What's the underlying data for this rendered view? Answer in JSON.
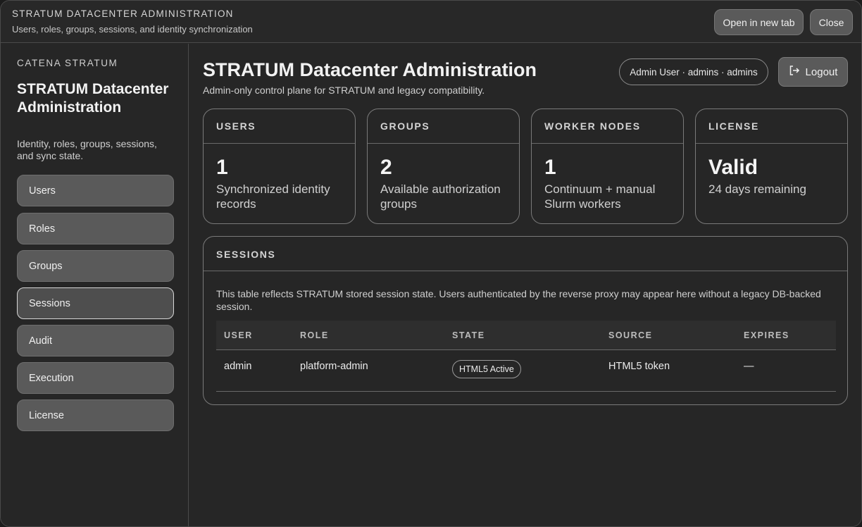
{
  "titlebar": {
    "heading": "STRATUM DATACENTER ADMINISTRATION",
    "subheading": "Users, roles, groups, sessions, and identity synchronization",
    "open_new_tab_label": "Open in new tab",
    "close_label": "Close"
  },
  "sidebar": {
    "brand": "CATENA STRATUM",
    "title": "STRATUM Datacenter Administration",
    "subtitle": "Identity, roles, groups, sessions, and sync state.",
    "items": [
      {
        "label": "Users"
      },
      {
        "label": "Roles"
      },
      {
        "label": "Groups"
      },
      {
        "label": "Sessions",
        "active": true
      },
      {
        "label": "Audit"
      },
      {
        "label": "Execution"
      },
      {
        "label": "License"
      }
    ]
  },
  "header": {
    "title": "STRATUM Datacenter Administration",
    "subtitle": "Admin-only control plane for STRATUM and legacy compatibility.",
    "user_pill": "Admin User · admins · admins",
    "logout_label": "Logout",
    "logout_icon": "logout-icon"
  },
  "cards": [
    {
      "heading": "USERS",
      "value": "1",
      "description": "Synchronized identity records"
    },
    {
      "heading": "GROUPS",
      "value": "2",
      "description": "Available authorization groups"
    },
    {
      "heading": "WORKER NODES",
      "value": "1",
      "description": "Continuum + manual Slurm workers"
    },
    {
      "heading": "LICENSE",
      "value": "Valid",
      "description": "24 days remaining"
    }
  ],
  "sessions": {
    "heading": "SESSIONS",
    "note": "This table reflects STRATUM stored session state. Users authenticated by the reverse proxy may appear here without a legacy DB-backed session.",
    "columns": [
      "USER",
      "ROLE",
      "STATE",
      "SOURCE",
      "EXPIRES"
    ],
    "rows": [
      {
        "user": "admin",
        "role": "platform-admin",
        "state": "HTML5 Active",
        "source": "HTML5 token",
        "expires": "—"
      }
    ]
  }
}
